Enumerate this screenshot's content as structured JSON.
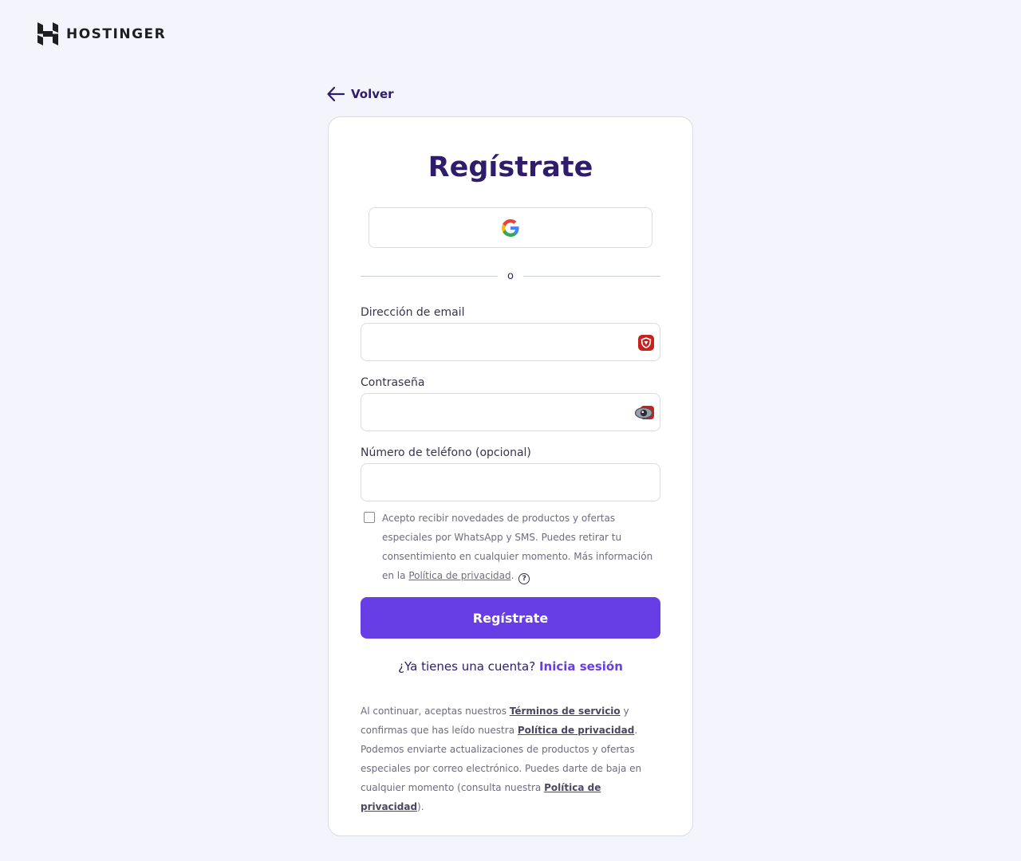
{
  "header": {
    "brand": "HOSTINGER"
  },
  "nav": {
    "back_label": "Volver"
  },
  "form": {
    "title": "Regístrate",
    "divider_text": "o",
    "email_label": "Dirección de email",
    "email_value": "",
    "password_label": "Contraseña",
    "password_value": "",
    "phone_label": "Número de teléfono (opcional)",
    "phone_value": "",
    "consent": {
      "text": "Acepto recibir novedades de productos y ofertas especiales por WhatsApp y SMS. Puedes retirar tu consentimiento en cualquier momento. Más información en la ",
      "link": "Política de privacidad",
      "after": ".",
      "help": "?"
    },
    "submit_label": "Regístrate",
    "login_prompt": "¿Ya tienes una cuenta?",
    "login_link": "Inicia sesión"
  },
  "legal": {
    "part1": "Al continuar, aceptas nuestros ",
    "terms_link": "Términos de servicio",
    "part2": " y confirmas que has leído nuestra ",
    "privacy_link_1": "Política de privacidad",
    "part3": ". Podemos enviarte actualizaciones de productos y ofertas especiales por correo electrónico. Puedes darte de baja en cualquier momento (consulta nuestra ",
    "privacy_link_2": "Política de privacidad",
    "part4": ")."
  },
  "colors": {
    "accent": "#673de6",
    "heading": "#2f1c6a",
    "background": "#f4f4fc"
  },
  "icons": {
    "logo": "hostinger-logo-icon",
    "back": "arrow-left-icon",
    "google": "google-icon",
    "email_ext": "password-manager-icon",
    "password_ext": "eye-icon",
    "help": "question-circle-icon"
  }
}
